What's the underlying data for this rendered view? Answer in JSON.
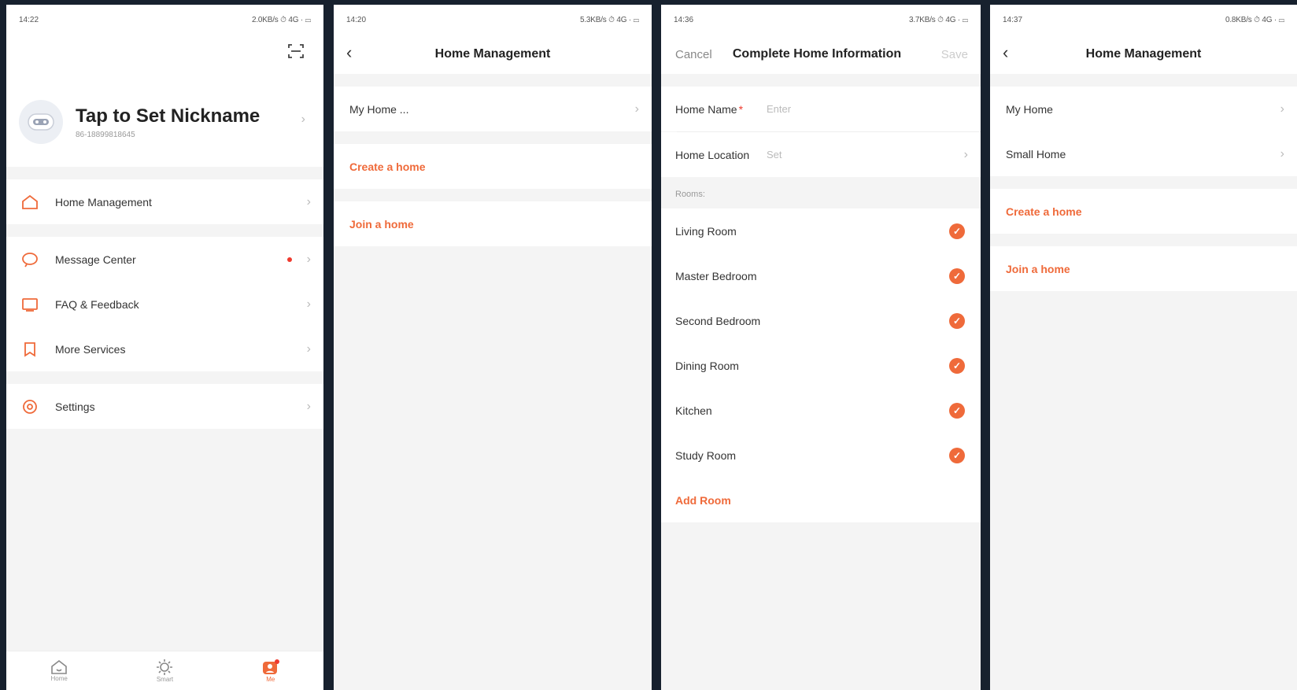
{
  "screens": {
    "me": {
      "status_time": "14:22",
      "status_right": "2.0KB/s ⏱ 4G · ▭",
      "nickname": "Tap to Set Nickname",
      "phone": "86-18899818645",
      "menu": [
        {
          "label": "Home Management",
          "icon": "home-icon"
        },
        {
          "label": "Message Center",
          "icon": "message-icon"
        },
        {
          "label": "FAQ & Feedback",
          "icon": "feedback-icon"
        },
        {
          "label": "More Services",
          "icon": "bookmark-icon"
        },
        {
          "label": "Settings",
          "icon": "settings-icon"
        }
      ],
      "tabs": [
        {
          "label": "Home",
          "icon": "home-tab-icon"
        },
        {
          "label": "Smart",
          "icon": "smart-tab-icon"
        },
        {
          "label": "Me",
          "icon": "me-tab-icon"
        }
      ]
    },
    "home_mgmt_1": {
      "status_time": "14:20",
      "status_right": "5.3KB/s ⏱ 4G · ▭",
      "title": "Home Management",
      "homes": [
        "My Home ..."
      ],
      "create": "Create a home",
      "join": "Join a home"
    },
    "complete_info": {
      "status_time": "14:36",
      "status_right": "3.7KB/s ⏱ 4G · ▭",
      "cancel": "Cancel",
      "title": "Complete Home Information",
      "save": "Save",
      "home_name_label": "Home Name",
      "home_name_placeholder": "Enter",
      "location_label": "Home Location",
      "location_value": "Set",
      "rooms_label": "Rooms:",
      "rooms": [
        "Living Room",
        "Master Bedroom",
        "Second Bedroom",
        "Dining Room",
        "Kitchen",
        "Study Room"
      ],
      "add_room": "Add Room"
    },
    "home_mgmt_2": {
      "status_time": "14:37",
      "status_right": "0.8KB/s ⏱ 4G · ▭",
      "title": "Home Management",
      "homes": [
        "My Home",
        "Small Home"
      ],
      "create": "Create a home",
      "join": "Join a home"
    }
  },
  "colors": {
    "accent": "#ef6a3a",
    "background": "#17212e"
  }
}
